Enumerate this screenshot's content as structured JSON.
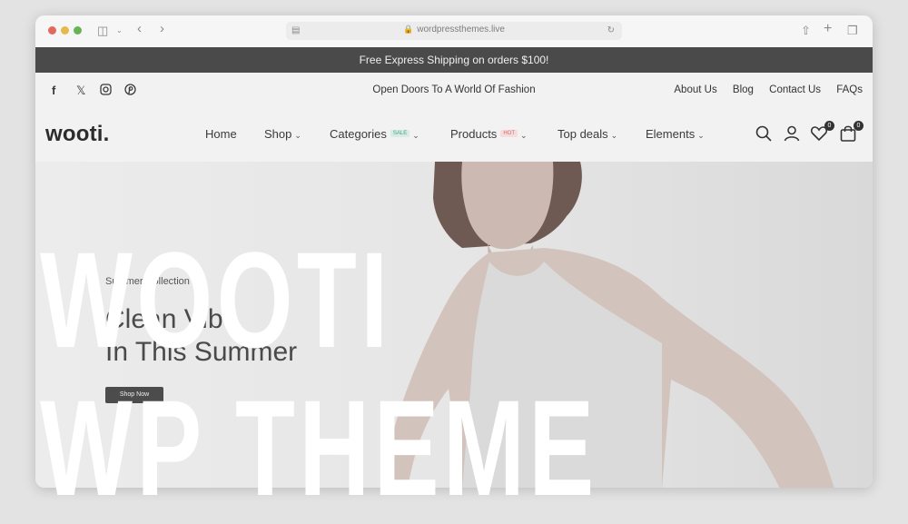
{
  "browser": {
    "url": "wordpressthemes.live"
  },
  "announcement": {
    "text": "Free Express Shipping on orders $100!"
  },
  "topbar": {
    "promo": "Open Doors To A World Of Fashion",
    "links": [
      "About Us",
      "Blog",
      "Contact Us",
      "FAQs"
    ],
    "social_icons": [
      "facebook-icon",
      "x-icon",
      "instagram-icon",
      "pinterest-icon"
    ]
  },
  "header": {
    "logo": "wooti.",
    "nav": [
      {
        "label": "Home",
        "badge": ""
      },
      {
        "label": "Shop",
        "badge": ""
      },
      {
        "label": "Categories",
        "badge": "SALE"
      },
      {
        "label": "Products",
        "badge": "HOT"
      },
      {
        "label": "Top deals",
        "badge": ""
      },
      {
        "label": "Elements",
        "badge": ""
      }
    ],
    "wishlist_count": "0",
    "cart_count": "0"
  },
  "hero": {
    "eyebrow": "Summer Collection",
    "title_line1": "Clean Vibe",
    "title_line2": "In This Summer",
    "button": "Shop Now"
  },
  "overlay": {
    "line1": "WOOTI",
    "line2": "WP THEME"
  },
  "colors": {
    "shipping_bar": "#4a4a4a",
    "sale_badge": "#4aa386",
    "hot_badge": "#d46b6b"
  }
}
